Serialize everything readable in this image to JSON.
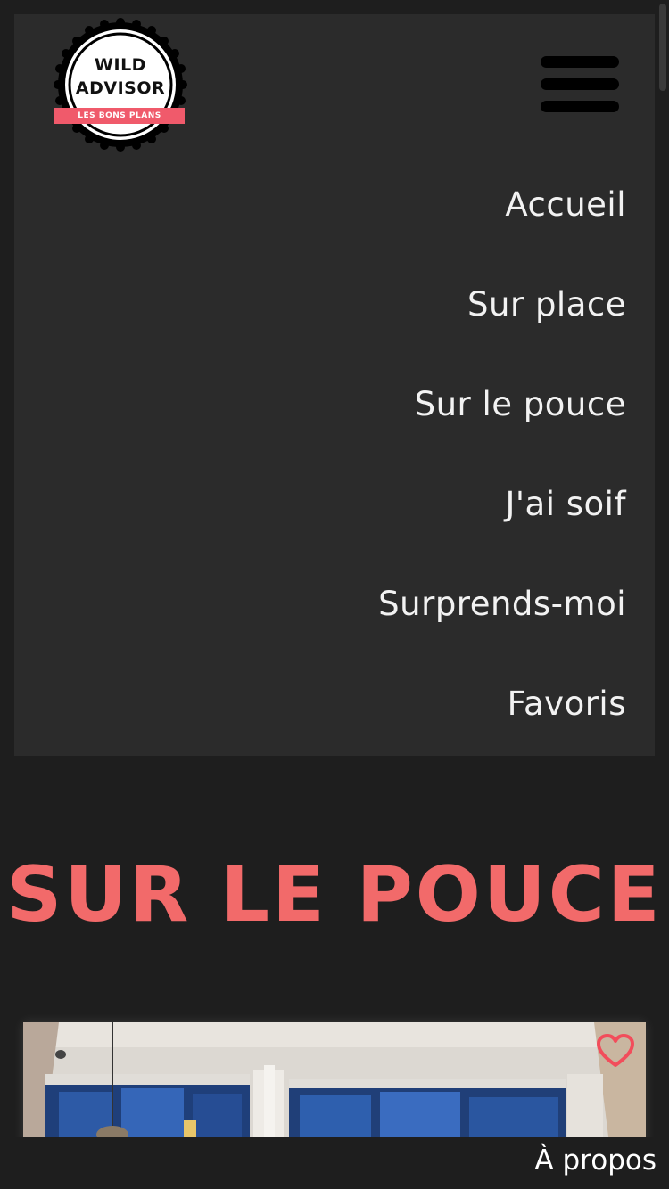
{
  "logo": {
    "line1": "WILD",
    "line2": "ADVISOR",
    "ribbon": "LES BONS PLANS"
  },
  "nav": {
    "items": [
      {
        "label": "Accueil"
      },
      {
        "label": "Sur place"
      },
      {
        "label": "Sur le pouce"
      },
      {
        "label": "J'ai soif"
      },
      {
        "label": "Surprends-moi"
      },
      {
        "label": "Favoris"
      }
    ]
  },
  "main": {
    "title": "SUR LE POUCE"
  },
  "footer": {
    "about_label": "À propos"
  },
  "icons": {
    "menu": "hamburger-menu-icon",
    "favorite": "heart-outline-icon"
  },
  "colors": {
    "accent": "#f26a6a",
    "ribbon": "#f05a6b",
    "background": "#1e1e1e",
    "panel": "#2b2b2b",
    "nav_text": "#f2f2f2"
  }
}
